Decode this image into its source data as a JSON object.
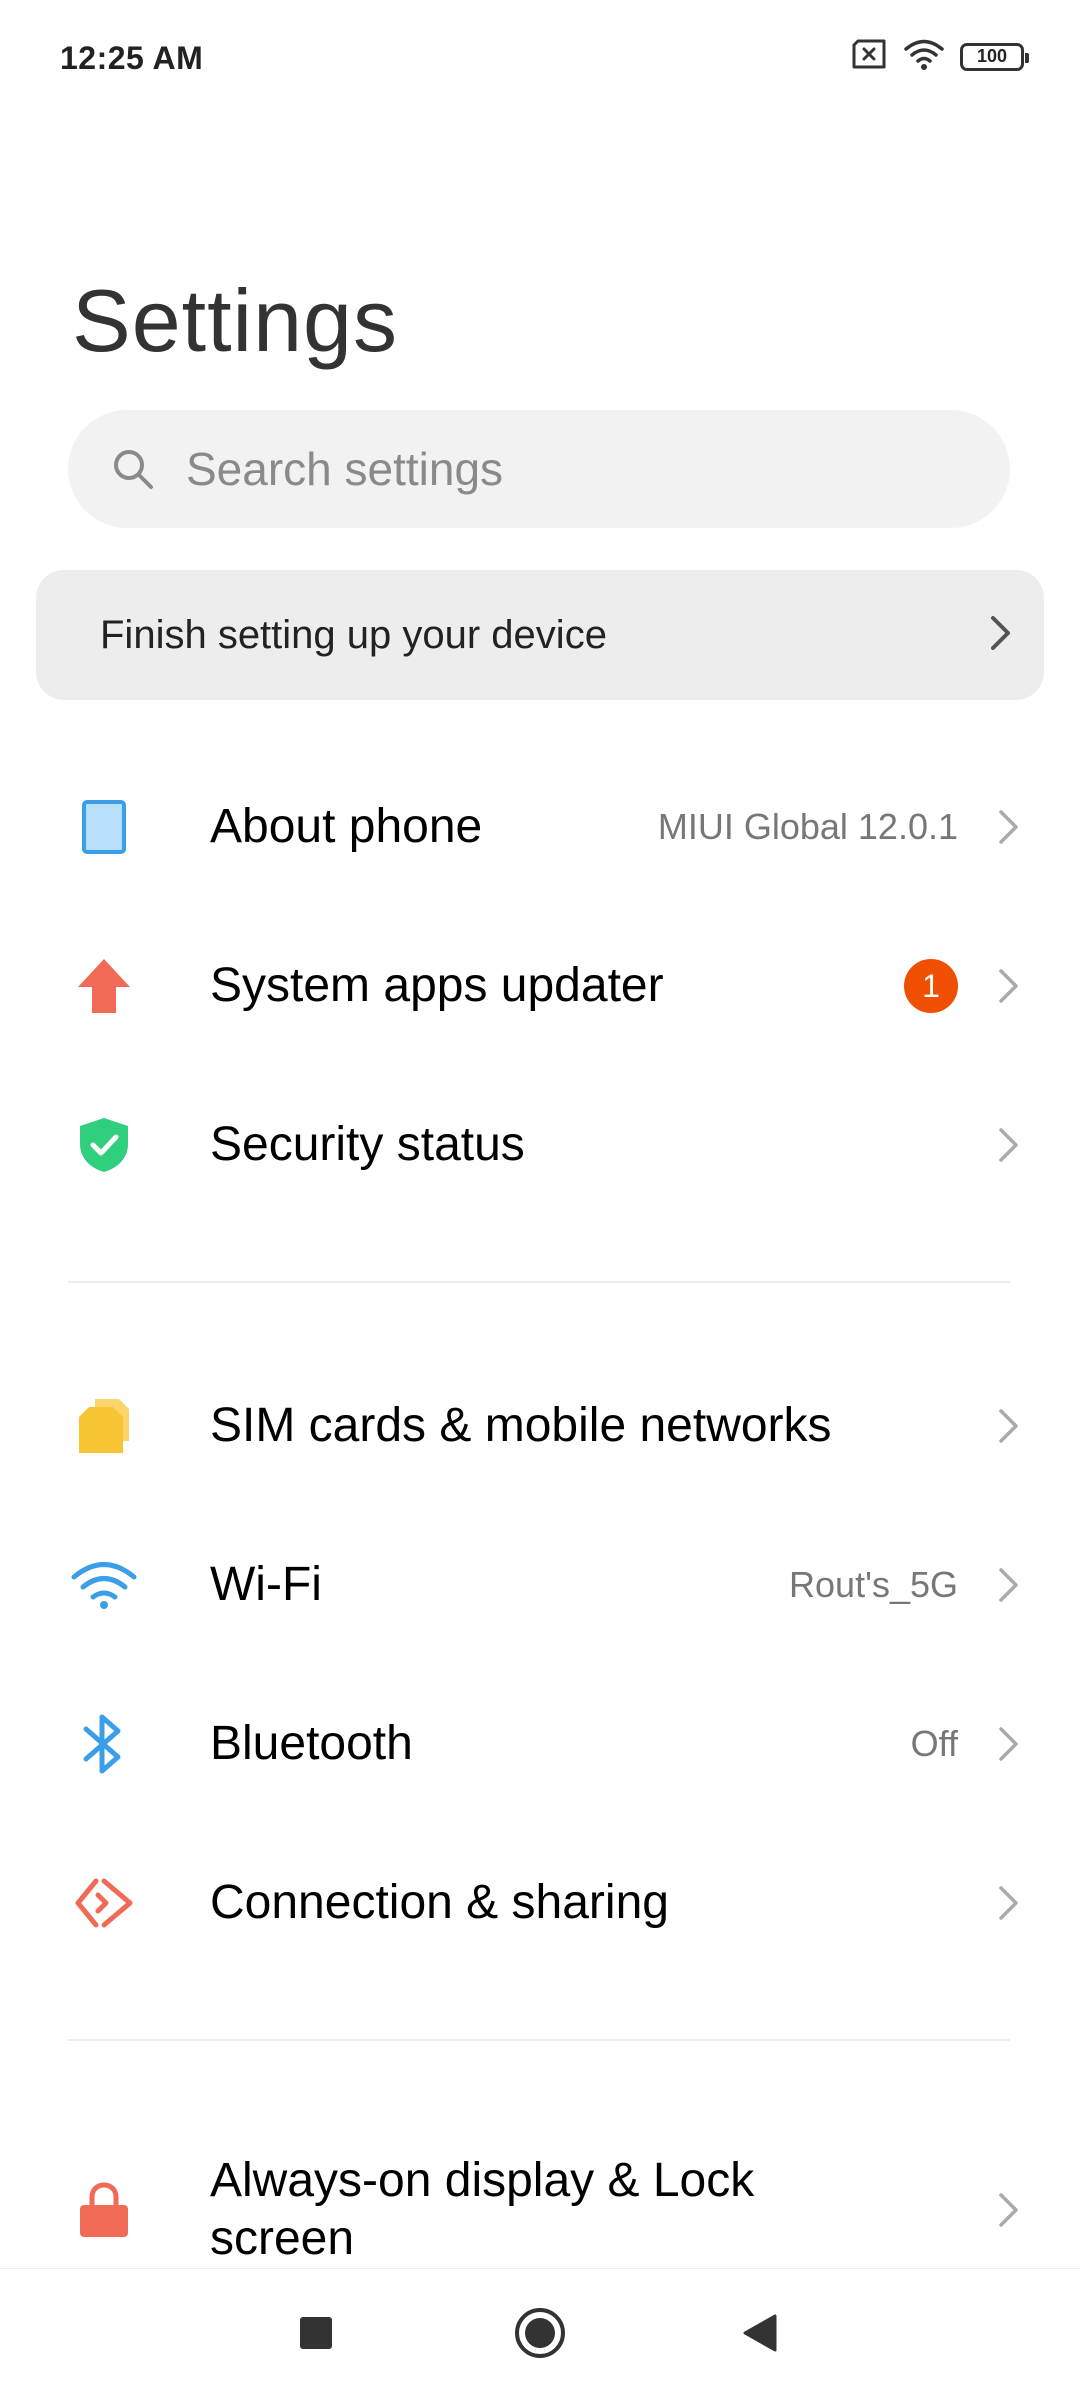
{
  "status_bar": {
    "time": "12:25 AM",
    "battery": "100"
  },
  "page": {
    "title": "Settings"
  },
  "search": {
    "placeholder": "Search settings"
  },
  "setup_card": {
    "label": "Finish setting up your device"
  },
  "groups": [
    {
      "items": [
        {
          "label": "About phone",
          "value": "MIUI Global 12.0.1",
          "icon": "phone-icon",
          "color": "#3a9ee8"
        },
        {
          "label": "System apps updater",
          "badge": "1",
          "icon": "arrow-up-icon",
          "color": "#f06a55"
        },
        {
          "label": "Security status",
          "icon": "shield-check-icon",
          "color": "#2fcf7e"
        }
      ]
    },
    {
      "items": [
        {
          "label": "SIM cards & mobile networks",
          "icon": "sim-card-icon",
          "color": "#f7c533"
        },
        {
          "label": "Wi-Fi",
          "value": "Rout's_5G",
          "icon": "wifi-icon",
          "color": "#3a9ee8"
        },
        {
          "label": "Bluetooth",
          "value": "Off",
          "icon": "bluetooth-icon",
          "color": "#3a9ee8"
        },
        {
          "label": "Connection & sharing",
          "icon": "connection-sharing-icon",
          "color": "#f06a55"
        }
      ]
    },
    {
      "items": [
        {
          "label_line1": "Always-on display & Lock",
          "label_line2": "screen",
          "icon": "lock-icon",
          "color": "#f06a55"
        }
      ]
    }
  ],
  "badge_color": "#f04e00",
  "nav_bar": {
    "recents": "square-icon",
    "home": "circle-icon",
    "back": "triangle-back-icon"
  }
}
